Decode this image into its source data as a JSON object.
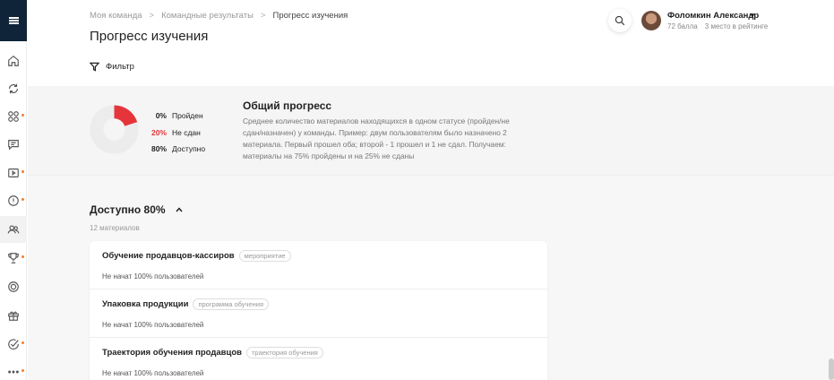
{
  "breadcrumb": [
    "Моя команда",
    "Командные результаты",
    "Прогресс изучения"
  ],
  "page_title": "Прогресс изучения",
  "filter_label": "Фильтр",
  "user": {
    "name": "Фоломкин Александр",
    "points": "72 балла",
    "rank": "3 место в рейтинге"
  },
  "progress": {
    "title": "Общий прогресс",
    "description": "Среднее количество материалов находящихся в одном статусе (пройден/не сдан/назначен) у команды. Пример: двум пользователям было назначено 2 материала. Первый прошел оба; второй - 1 прошел и 1 не сдал. Получаем: материалы на 75% пройдены и на 25% не сданы",
    "legend": [
      {
        "pct": "0%",
        "label": "Пройден",
        "value": 0,
        "color": "#2e9e5b"
      },
      {
        "pct": "20%",
        "label": "Не сдан",
        "value": 20,
        "color": "#e5353a"
      },
      {
        "pct": "80%",
        "label": "Доступно",
        "value": 80,
        "color": "#ececec"
      }
    ]
  },
  "section": {
    "title": "Доступно 80%",
    "count": "12 материалов"
  },
  "materials": [
    {
      "name": "Обучение продавцов-кассиров",
      "tag": "мероприятие",
      "status": "Не начат 100% пользователей"
    },
    {
      "name": "Упаковка продукции",
      "tag": "программа обучения",
      "status": "Не начат 100% пользователей"
    },
    {
      "name": "Траектория обучения продавцов",
      "tag": "траектория обучения",
      "status": "Не начат 100% пользователей"
    }
  ],
  "rail_icons": [
    "home-icon",
    "sync-icon",
    "grid-icon",
    "chat-icon",
    "play-icon",
    "info-icon",
    "team-icon",
    "trophy-icon",
    "globe-icon",
    "gift-icon",
    "check-icon",
    "more-icon"
  ]
}
